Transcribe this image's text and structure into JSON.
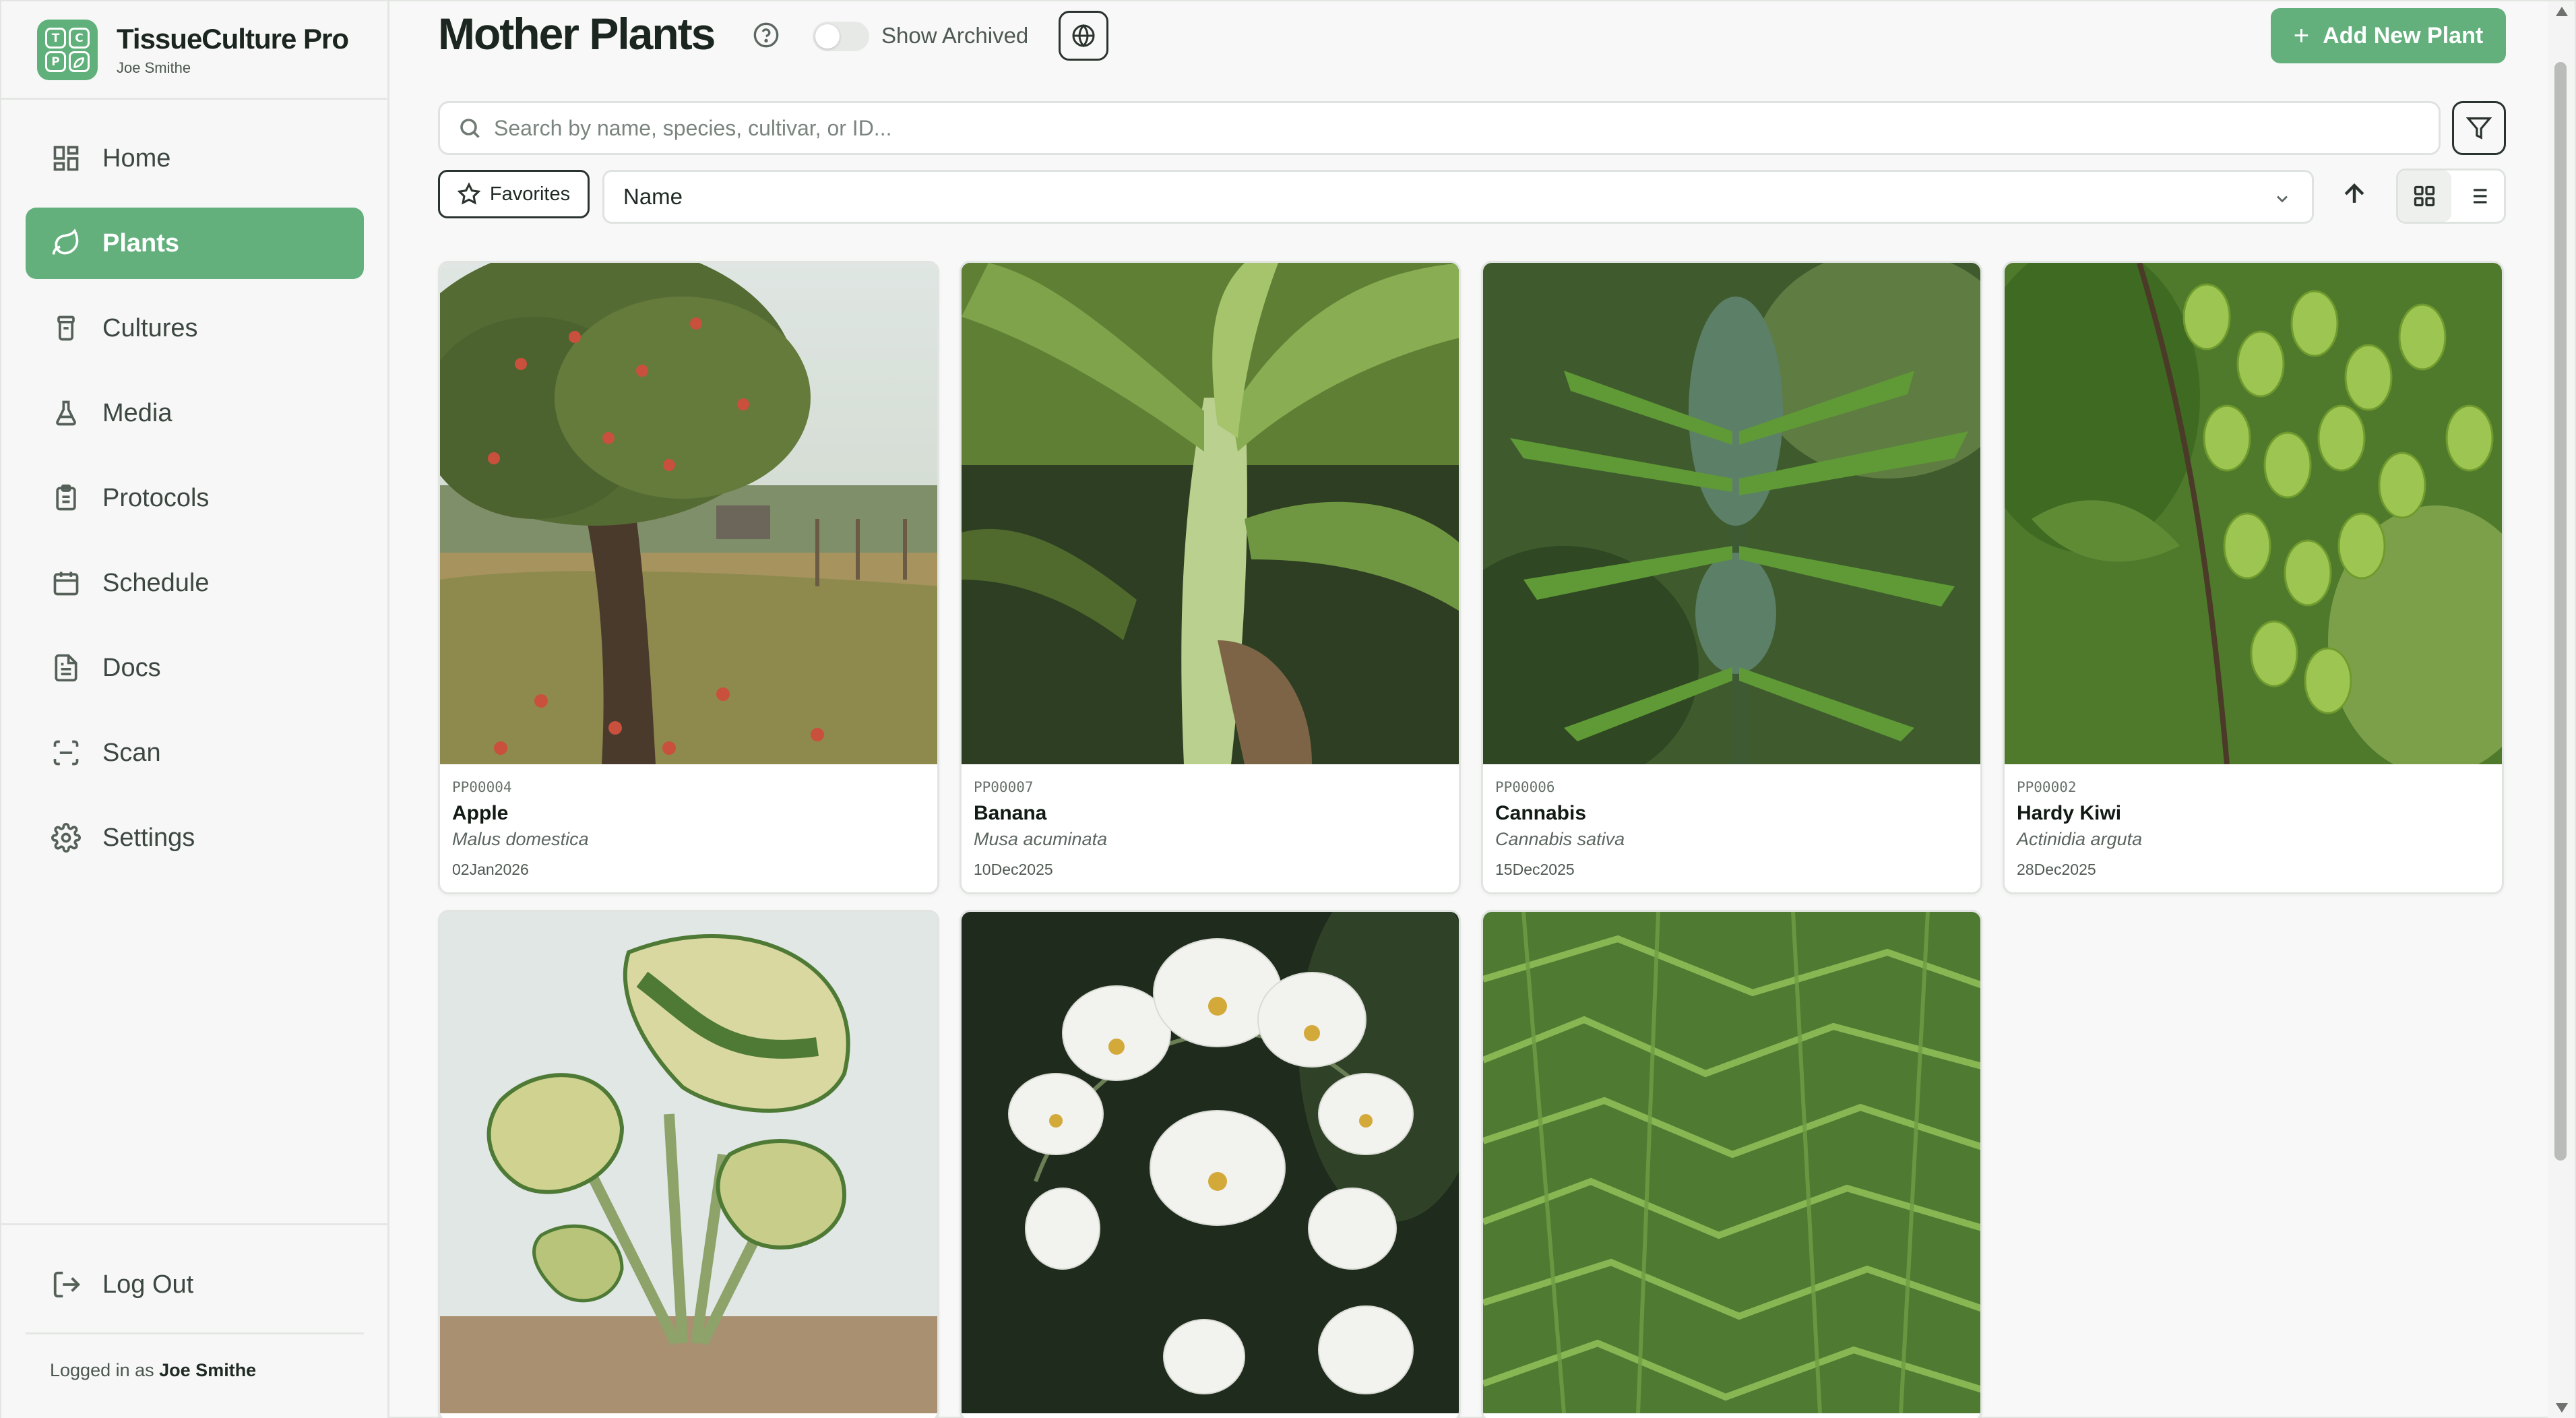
{
  "app": {
    "name": "TissueCulture Pro",
    "user": "Joe Smithe",
    "logo_letters": [
      "T",
      "C",
      "P",
      ""
    ]
  },
  "sidebar": {
    "items": [
      {
        "label": "Home",
        "icon": "home-grid-icon"
      },
      {
        "label": "Plants",
        "icon": "leaf-icon",
        "active": true
      },
      {
        "label": "Cultures",
        "icon": "jar-icon"
      },
      {
        "label": "Media",
        "icon": "flask-icon"
      },
      {
        "label": "Protocols",
        "icon": "clipboard-icon"
      },
      {
        "label": "Schedule",
        "icon": "calendar-icon"
      },
      {
        "label": "Docs",
        "icon": "document-icon"
      },
      {
        "label": "Scan",
        "icon": "scan-icon"
      },
      {
        "label": "Settings",
        "icon": "gear-icon"
      }
    ],
    "logout_label": "Log Out",
    "logged_in_prefix": "Logged in as",
    "logged_in_user": "Joe Smithe"
  },
  "header": {
    "title": "Mother Plants",
    "show_archived_label": "Show Archived",
    "show_archived_on": false,
    "add_button_label": "Add New Plant"
  },
  "search": {
    "placeholder": "Search by name, species, cultivar, or ID...",
    "value": ""
  },
  "toolbar": {
    "favorites_label": "Favorites",
    "sort_value": "Name",
    "sort_direction": "ascending",
    "view_mode": "grid"
  },
  "plants": [
    {
      "id": "PP00004",
      "name": "Apple",
      "species": "Malus domestica",
      "date": "02Jan2026",
      "image": "apple-tree-photo"
    },
    {
      "id": "PP00007",
      "name": "Banana",
      "species": "Musa acuminata",
      "date": "10Dec2025",
      "image": "banana-plant-photo"
    },
    {
      "id": "PP00006",
      "name": "Cannabis",
      "species": "Cannabis sativa",
      "date": "15Dec2025",
      "image": "cannabis-plant-photo"
    },
    {
      "id": "PP00002",
      "name": "Hardy Kiwi",
      "species": "Actinidia arguta",
      "date": "28Dec2025",
      "image": "hardy-kiwi-photo"
    },
    {
      "id": "",
      "name": "",
      "species": "",
      "date": "",
      "image": "variegated-monstera-photo"
    },
    {
      "id": "",
      "name": "",
      "species": "",
      "date": "",
      "image": "white-orchid-photo"
    },
    {
      "id": "",
      "name": "",
      "species": "",
      "date": "",
      "image": "fern-leaf-shrub-photo"
    }
  ],
  "colors": {
    "accent": "#63b07d",
    "sidebar_bg": "#f6f7f6",
    "page_bg": "#f7f8f7"
  }
}
